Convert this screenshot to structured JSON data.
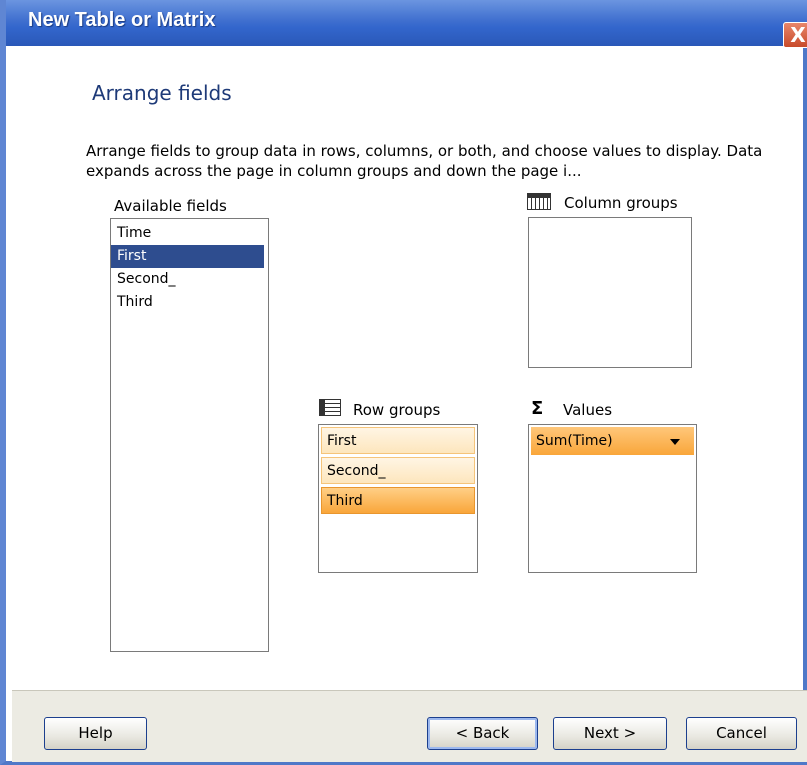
{
  "window": {
    "title": "New Table or Matrix",
    "close_glyph": "X",
    "close_icon": "close-icon"
  },
  "page": {
    "heading": "Arrange fields",
    "description": "Arrange fields to group data in rows, columns, or both, and choose values to display. Data expands across the page in column groups and down the page i..."
  },
  "available_fields": {
    "label": "Available fields",
    "items": [
      {
        "label": "Time",
        "selected": false
      },
      {
        "label": "First",
        "selected": true
      },
      {
        "label": "Second_",
        "selected": false
      },
      {
        "label": "Third",
        "selected": false
      }
    ]
  },
  "column_groups": {
    "label": "Column groups",
    "icon": "column-groups-icon",
    "items": []
  },
  "row_groups": {
    "label": "Row groups",
    "icon": "row-groups-icon",
    "items": [
      {
        "label": "First",
        "selected": false
      },
      {
        "label": "Second_",
        "selected": false
      },
      {
        "label": "Third",
        "selected": true
      }
    ]
  },
  "values": {
    "label": "Values",
    "icon_glyph": "Σ",
    "icon": "sigma-icon",
    "items": [
      {
        "label": "Sum(Time)",
        "dropdown": "chevron-down-icon"
      }
    ]
  },
  "footer": {
    "help": "Help",
    "back": "< Back",
    "next": "Next >",
    "cancel": "Cancel"
  },
  "colors": {
    "titlebar": "#3366cc",
    "heading": "#1e3a78",
    "selection": "#2e4d8f",
    "group_item": "#fde6bd",
    "group_item_selected": "#f9a63a",
    "footer_bg": "#ecebe3"
  }
}
